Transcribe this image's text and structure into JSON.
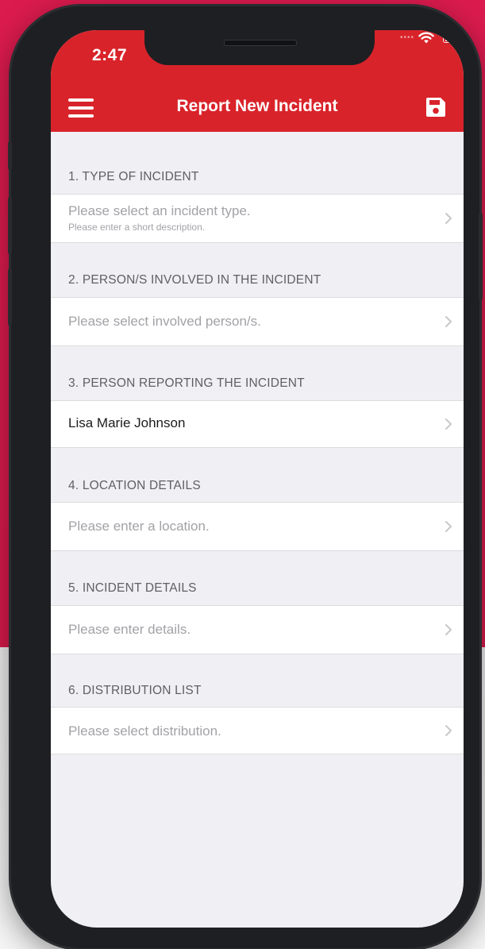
{
  "status_bar": {
    "time": "2:47"
  },
  "nav_bar": {
    "title": "Report New Incident",
    "menu_icon": "hamburger-menu-icon",
    "save_icon": "floppy-disk-save-icon",
    "background_color": "#d9232a"
  },
  "form": {
    "sections": [
      {
        "header": "1. TYPE OF INCIDENT",
        "value": "Please select an incident type.",
        "subtitle": "Please enter a short description.",
        "is_placeholder": true
      },
      {
        "header": "2. PERSON/S INVOLVED IN THE INCIDENT",
        "value": "Please select involved person/s.",
        "is_placeholder": true
      },
      {
        "header": "3. PERSON REPORTING THE INCIDENT",
        "value": "Lisa Marie Johnson",
        "is_placeholder": false
      },
      {
        "header": "4. LOCATION DETAILS",
        "value": "Please enter a location.",
        "is_placeholder": true
      },
      {
        "header": "5. INCIDENT DETAILS",
        "value": "Please enter details.",
        "is_placeholder": true
      },
      {
        "header": "6. DISTRIBUTION LIST",
        "value": "Please select distribution.",
        "is_placeholder": true
      }
    ]
  },
  "colors": {
    "brand_red": "#d9232a",
    "backdrop_pink": "#db1b4e",
    "screen_background": "#efeff4",
    "placeholder_text": "#a2a2a7",
    "section_header_text": "#5f5f64"
  }
}
